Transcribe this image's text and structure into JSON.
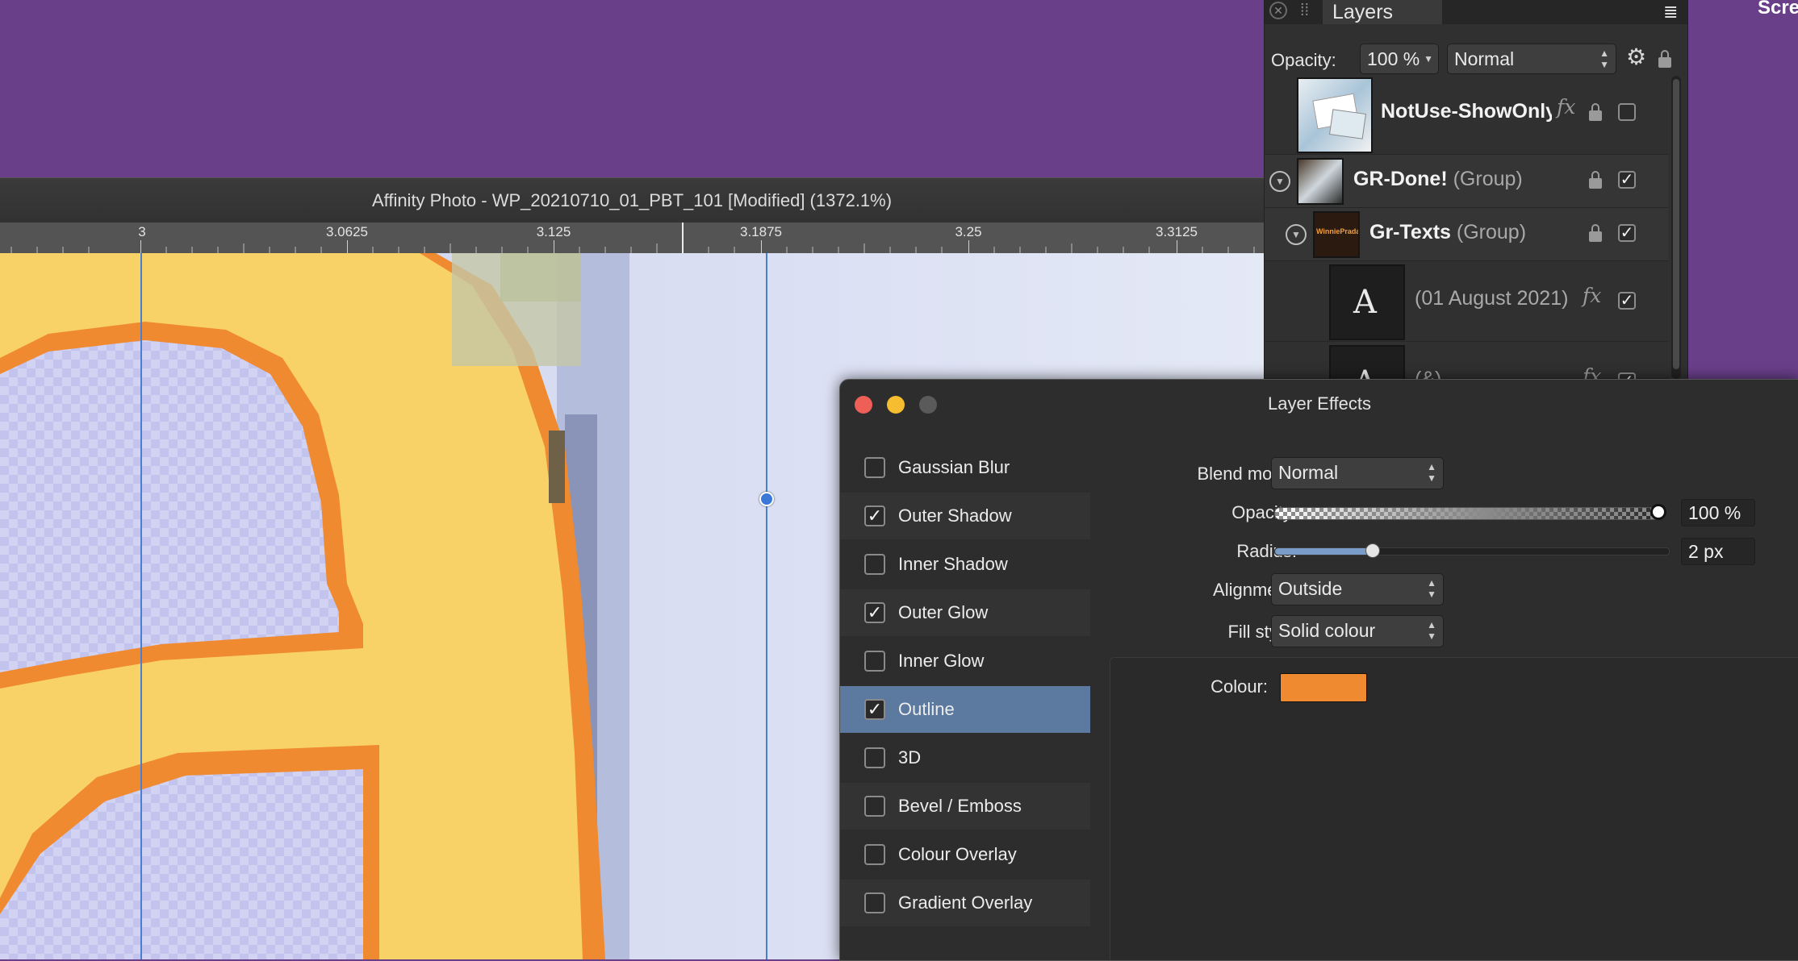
{
  "colors": {
    "desktop": "#6a3f8a",
    "outline_colour": "#f08a30",
    "letter_fill": "#f9d267",
    "guide": "#4a7fd0",
    "selected_row": "#5c7aa0"
  },
  "desktop": {
    "edge_label": "Scre"
  },
  "document": {
    "title": "Affinity Photo - WP_20210710_01_PBT_101 [Modified] (1372.1%)",
    "ruler_ticks": [
      "3",
      "3.0625",
      "3.125",
      "3.1875",
      "3.25",
      "3.3125"
    ]
  },
  "layers_panel": {
    "tab_label": "Layers",
    "opacity_label": "Opacity:",
    "opacity_value": "100 %",
    "blend_mode": "Normal",
    "icons": [
      "close-icon",
      "grip-icon",
      "panel-menu-icon",
      "gear-icon",
      "lock-icon"
    ],
    "layers": [
      {
        "name": "NotUse-ShowOnly",
        "type": "",
        "fx": true,
        "locked": true,
        "visible": false
      },
      {
        "name": "GR-Done!",
        "type": "(Group)",
        "fx": false,
        "locked": true,
        "visible": true
      },
      {
        "name": "Gr-Texts",
        "type": "(Group)",
        "fx": false,
        "locked": true,
        "visible": true
      },
      {
        "name": "(01 August 2021)",
        "type": "",
        "fx": true,
        "locked": false,
        "visible": true
      },
      {
        "name": "(&)",
        "type": "",
        "fx": true,
        "locked": false,
        "visible": true
      }
    ],
    "thumb_letter": "A",
    "thumb_logo_text": "WinniePrada"
  },
  "layer_effects": {
    "title": "Layer Effects",
    "effects": [
      {
        "label": "Gaussian Blur",
        "checked": false
      },
      {
        "label": "Outer Shadow",
        "checked": true
      },
      {
        "label": "Inner Shadow",
        "checked": false
      },
      {
        "label": "Outer Glow",
        "checked": true
      },
      {
        "label": "Inner Glow",
        "checked": false
      },
      {
        "label": "Outline",
        "checked": true,
        "selected": true
      },
      {
        "label": "3D",
        "checked": false
      },
      {
        "label": "Bevel / Emboss",
        "checked": false
      },
      {
        "label": "Colour Overlay",
        "checked": false
      },
      {
        "label": "Gradient Overlay",
        "checked": false
      }
    ],
    "blend_mode_label": "Blend mode:",
    "blend_mode_value": "Normal",
    "opacity_label": "Opacity:",
    "opacity_value": "100 %",
    "opacity_fraction": 1.0,
    "radius_label": "Radius:",
    "radius_value": "2 px",
    "radius_fraction": 0.25,
    "alignment_label": "Alignment:",
    "alignment_value": "Outside",
    "fill_style_label": "Fill style:",
    "fill_style_value": "Solid colour",
    "colour_label": "Colour:"
  }
}
